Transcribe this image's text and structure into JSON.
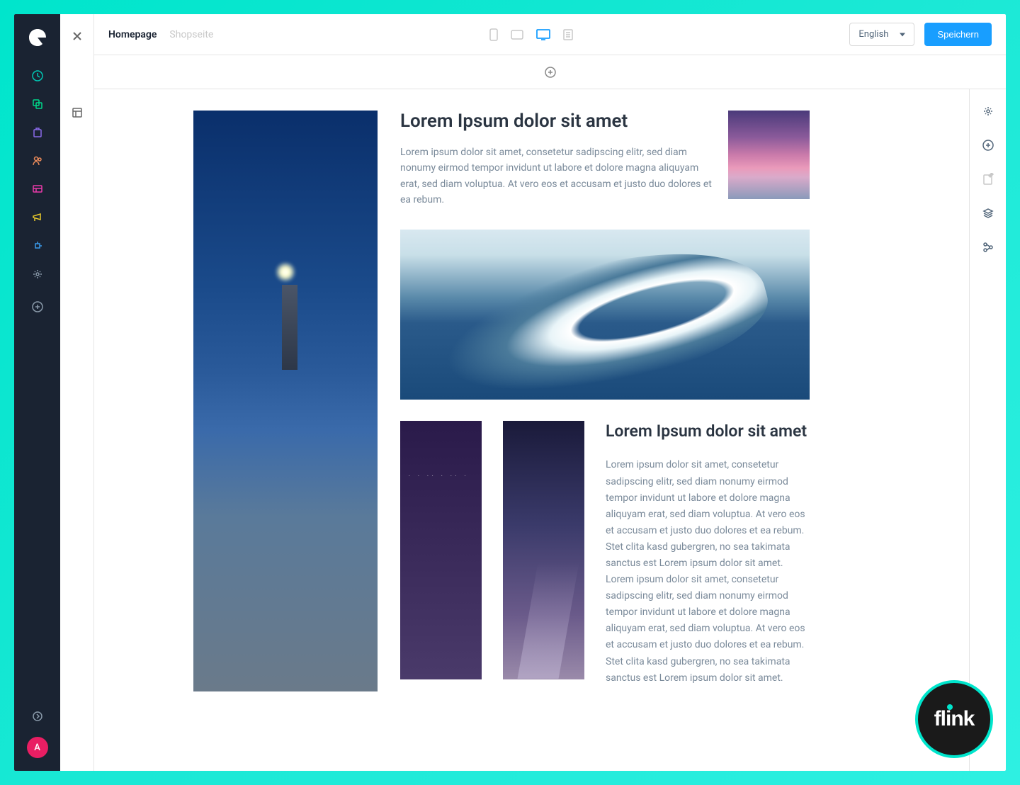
{
  "breadcrumb": {
    "active": "Homepage",
    "inactive": "Shopseite"
  },
  "topbar": {
    "language": "English",
    "save_label": "Speichern"
  },
  "content": {
    "block1": {
      "heading": "Lorem Ipsum dolor sit amet",
      "body": "Lorem ipsum dolor sit amet, consetetur sadipscing elitr, sed diam nonumy eirmod tempor invidunt ut labore et dolore magna aliquyam erat, sed diam voluptua. At vero eos et accusam et justo duo dolores et ea rebum."
    },
    "block2": {
      "heading": "Lorem Ipsum dolor sit amet",
      "body": "Lorem ipsum dolor sit amet, consetetur sadipscing elitr, sed diam nonumy eirmod tempor invidunt ut labore et dolore magna aliquyam erat, sed diam voluptua. At vero eos et accusam et justo duo dolores et ea rebum. Stet clita kasd gubergren, no sea takimata sanctus est Lorem ipsum dolor sit amet. Lorem ipsum dolor sit amet, consetetur sadipscing elitr, sed diam nonumy eirmod tempor invidunt ut labore et dolore magna aliquyam erat, sed diam voluptua. At vero eos et accusam et justo duo dolores et ea rebum. Stet clita kasd gubergren, no sea takimata sanctus est Lorem ipsum dolor sit amet."
    }
  },
  "avatar_letter": "A",
  "badge_text": "flink",
  "colors": {
    "nav_bg": "#1a2332",
    "accent": "#189eff",
    "frame": "#00e5cc"
  }
}
